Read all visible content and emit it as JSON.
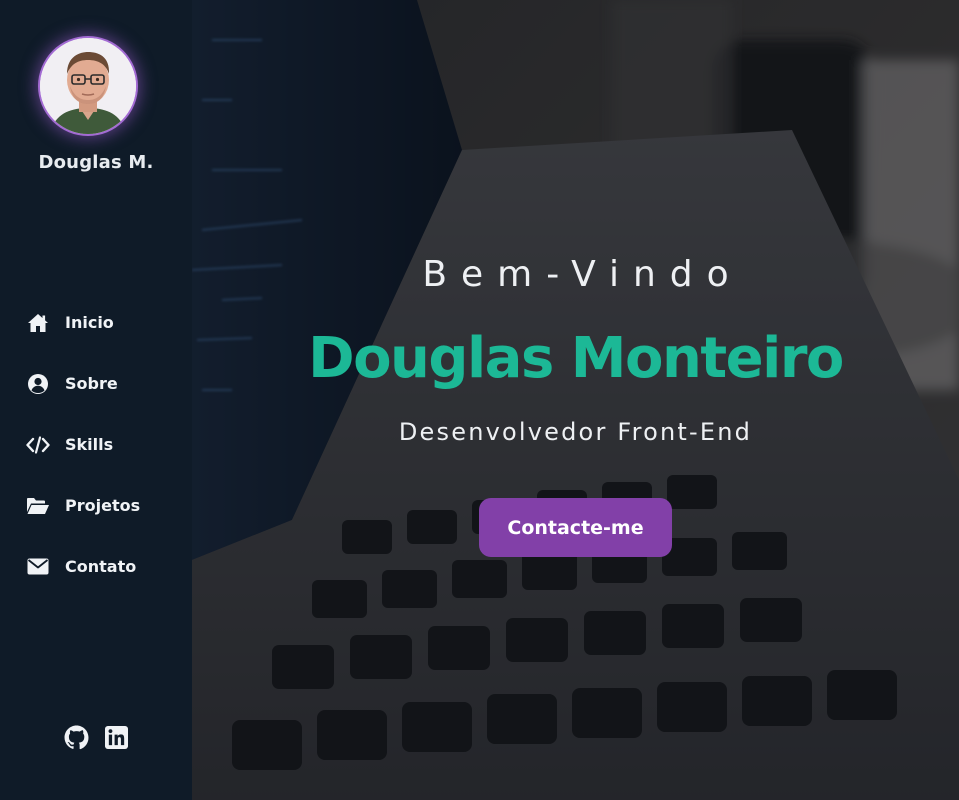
{
  "sidebar": {
    "profile_name": "Douglas M.",
    "nav": [
      {
        "label": "Inicio",
        "icon": "home-icon"
      },
      {
        "label": "Sobre",
        "icon": "user-circle-icon"
      },
      {
        "label": "Skills",
        "icon": "code-icon"
      },
      {
        "label": "Projetos",
        "icon": "folder-open-icon"
      },
      {
        "label": "Contato",
        "icon": "envelope-icon"
      }
    ],
    "social": [
      {
        "icon": "github-icon"
      },
      {
        "icon": "linkedin-icon"
      }
    ]
  },
  "hero": {
    "welcome": "Bem-Vindo",
    "name": "Douglas Monteiro",
    "role": "Desenvolvedor Front-End",
    "cta_label": "Contacte-me"
  },
  "colors": {
    "sidebar_bg": "#0f1b28",
    "accent_green": "#1cb896",
    "accent_purple": "#8240a8",
    "text_light": "#eef0f3"
  }
}
